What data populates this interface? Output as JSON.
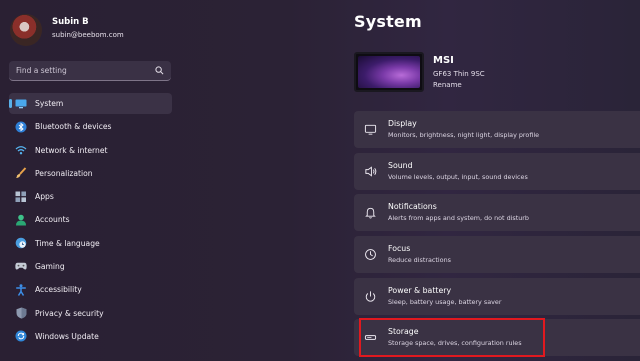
{
  "profile": {
    "name": "Subin B",
    "email": "subin@beebom.com"
  },
  "search": {
    "placeholder": "Find a setting"
  },
  "nav": {
    "items": [
      {
        "label": "System",
        "icon": "monitor-icon",
        "active": true
      },
      {
        "label": "Bluetooth & devices",
        "icon": "bluetooth-icon"
      },
      {
        "label": "Network & internet",
        "icon": "wifi-icon"
      },
      {
        "label": "Personalization",
        "icon": "brush-icon"
      },
      {
        "label": "Apps",
        "icon": "apps-icon"
      },
      {
        "label": "Accounts",
        "icon": "person-icon"
      },
      {
        "label": "Time & language",
        "icon": "globe-clock-icon"
      },
      {
        "label": "Gaming",
        "icon": "gamepad-icon"
      },
      {
        "label": "Accessibility",
        "icon": "accessibility-icon"
      },
      {
        "label": "Privacy & security",
        "icon": "shield-icon"
      },
      {
        "label": "Windows Update",
        "icon": "update-icon"
      }
    ]
  },
  "main": {
    "title": "System",
    "device": {
      "name": "MSI",
      "model": "GF63 Thin 9SC",
      "rename_label": "Rename"
    },
    "cards": [
      {
        "title": "Display",
        "subtitle": "Monitors, brightness, night light, display profile",
        "icon": "display-icon"
      },
      {
        "title": "Sound",
        "subtitle": "Volume levels, output, input, sound devices",
        "icon": "speaker-icon"
      },
      {
        "title": "Notifications",
        "subtitle": "Alerts from apps and system, do not disturb",
        "icon": "bell-icon"
      },
      {
        "title": "Focus",
        "subtitle": "Reduce distractions",
        "icon": "focus-icon"
      },
      {
        "title": "Power & battery",
        "subtitle": "Sleep, battery usage, battery saver",
        "icon": "power-icon"
      },
      {
        "title": "Storage",
        "subtitle": "Storage space, drives, configuration rules",
        "icon": "storage-icon"
      }
    ]
  },
  "colors": {
    "accent": "#5ab0e8",
    "highlight": "#e0191f"
  }
}
